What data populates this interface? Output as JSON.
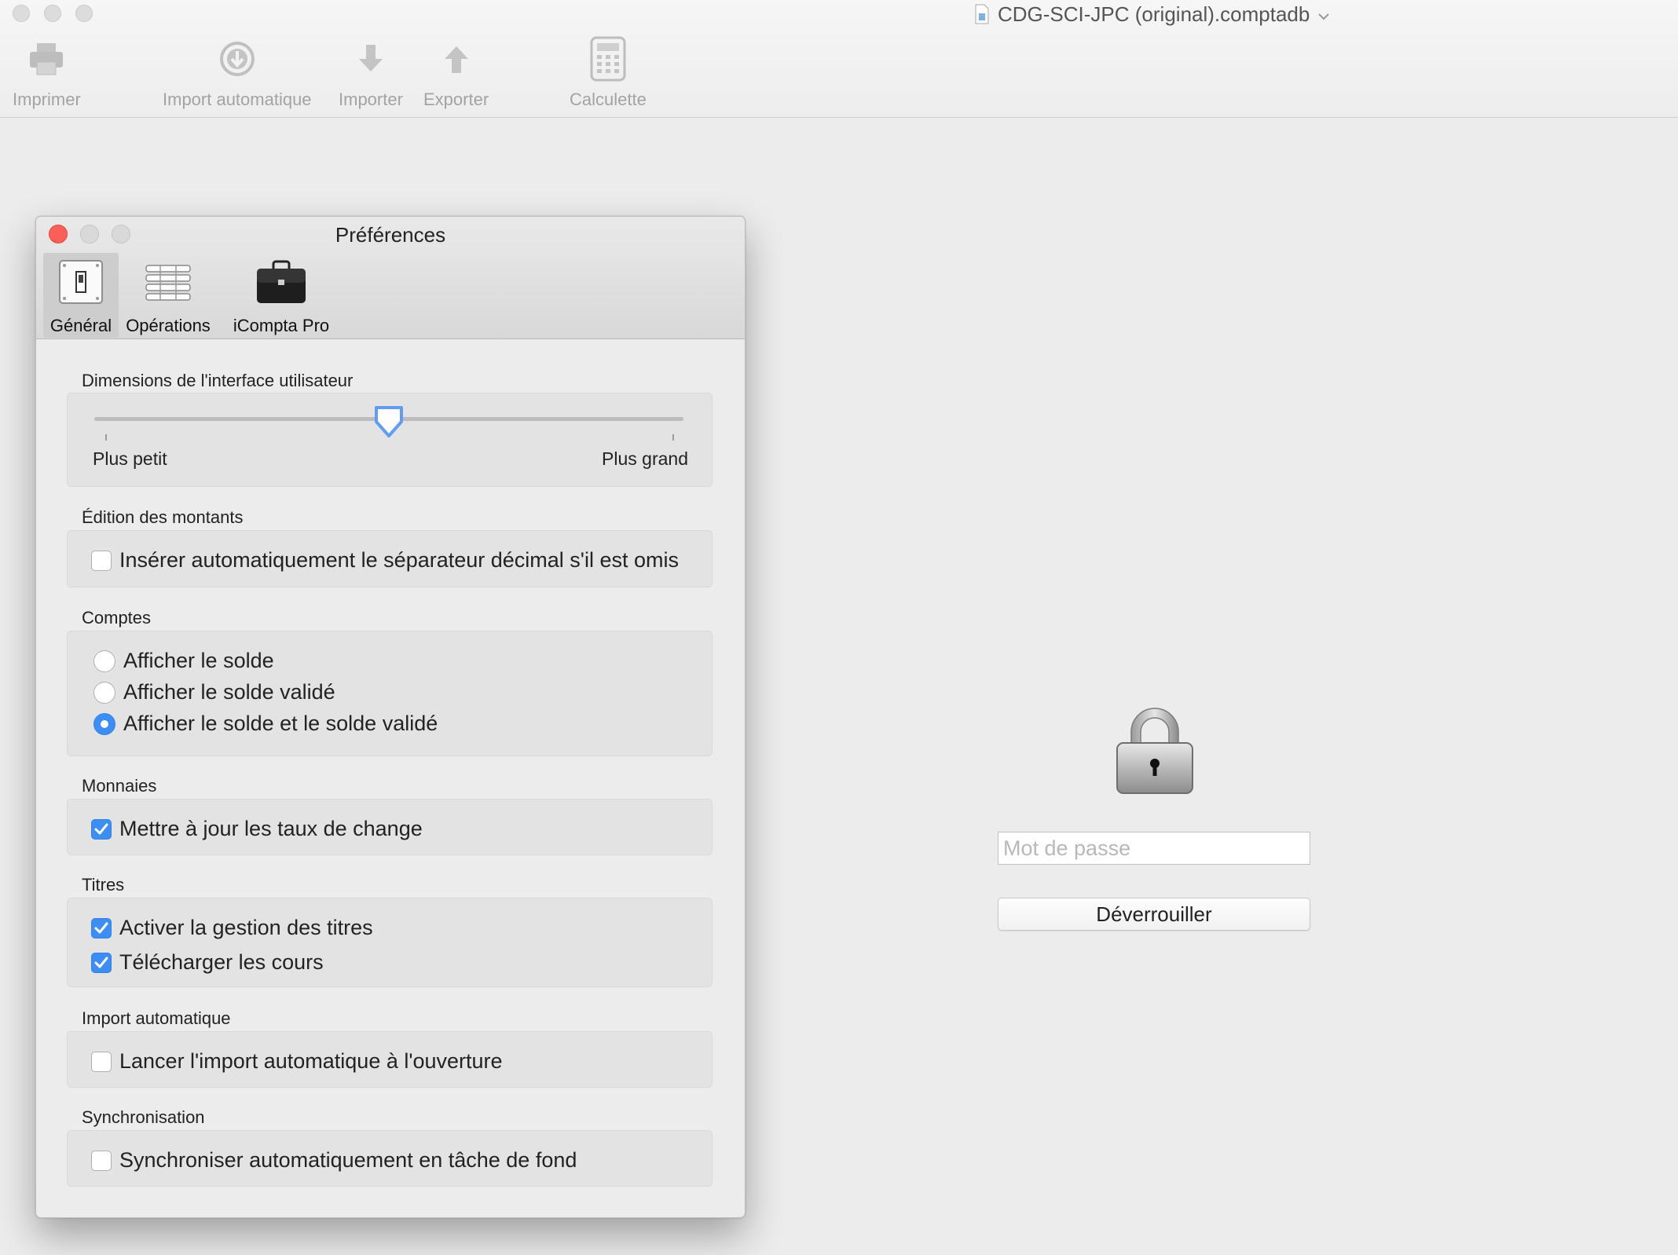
{
  "window": {
    "document_title": "CDG-SCI-JPC (original).comptadb"
  },
  "toolbar": {
    "items": [
      {
        "label": "Imprimer",
        "icon": "printer-icon"
      },
      {
        "label": "Import automatique",
        "icon": "download-circle-icon"
      },
      {
        "label": "Importer",
        "icon": "arrow-down-icon"
      },
      {
        "label": "Exporter",
        "icon": "arrow-up-icon"
      },
      {
        "label": "Calculette",
        "icon": "calculator-icon"
      }
    ]
  },
  "lock_screen": {
    "icon": "padlock-icon",
    "password_placeholder": "Mot de passe",
    "password_value": "",
    "unlock_label": "Déverrouiller"
  },
  "preferences": {
    "title": "Préférences",
    "tabs": [
      {
        "label": "Général",
        "icon": "switch-icon",
        "active": true
      },
      {
        "label": "Opérations",
        "icon": "list-icon",
        "active": false
      },
      {
        "label": "iCompta Pro",
        "icon": "briefcase-icon",
        "active": false
      }
    ],
    "ui_size": {
      "label": "Dimensions de l'interface utilisateur",
      "min_label": "Plus petit",
      "max_label": "Plus grand",
      "value": 0.5
    },
    "amounts": {
      "label": "Édition des montants",
      "auto_decimal": {
        "label": "Insérer automatiquement le séparateur décimal s'il est omis",
        "checked": false
      }
    },
    "accounts": {
      "label": "Comptes",
      "options": [
        {
          "label": "Afficher le solde",
          "selected": false
        },
        {
          "label": "Afficher le solde validé",
          "selected": false
        },
        {
          "label": "Afficher le solde et le solde validé",
          "selected": true
        }
      ]
    },
    "currencies": {
      "label": "Monnaies",
      "update_rates": {
        "label": "Mettre à jour les taux de change",
        "checked": true
      }
    },
    "securities": {
      "label": "Titres",
      "enable": {
        "label": "Activer la gestion des titres",
        "checked": true
      },
      "download_quotes": {
        "label": "Télécharger les cours",
        "checked": true
      }
    },
    "auto_import": {
      "label": "Import automatique",
      "on_open": {
        "label": "Lancer l'import automatique à l'ouverture",
        "checked": false
      }
    },
    "sync": {
      "label": "Synchronisation",
      "background": {
        "label": "Synchroniser automatiquement en tâche de fond",
        "checked": false
      }
    }
  },
  "colors": {
    "accent": "#3d8ef4",
    "close_button": "#fc5f57",
    "window_background": "#ececec"
  }
}
